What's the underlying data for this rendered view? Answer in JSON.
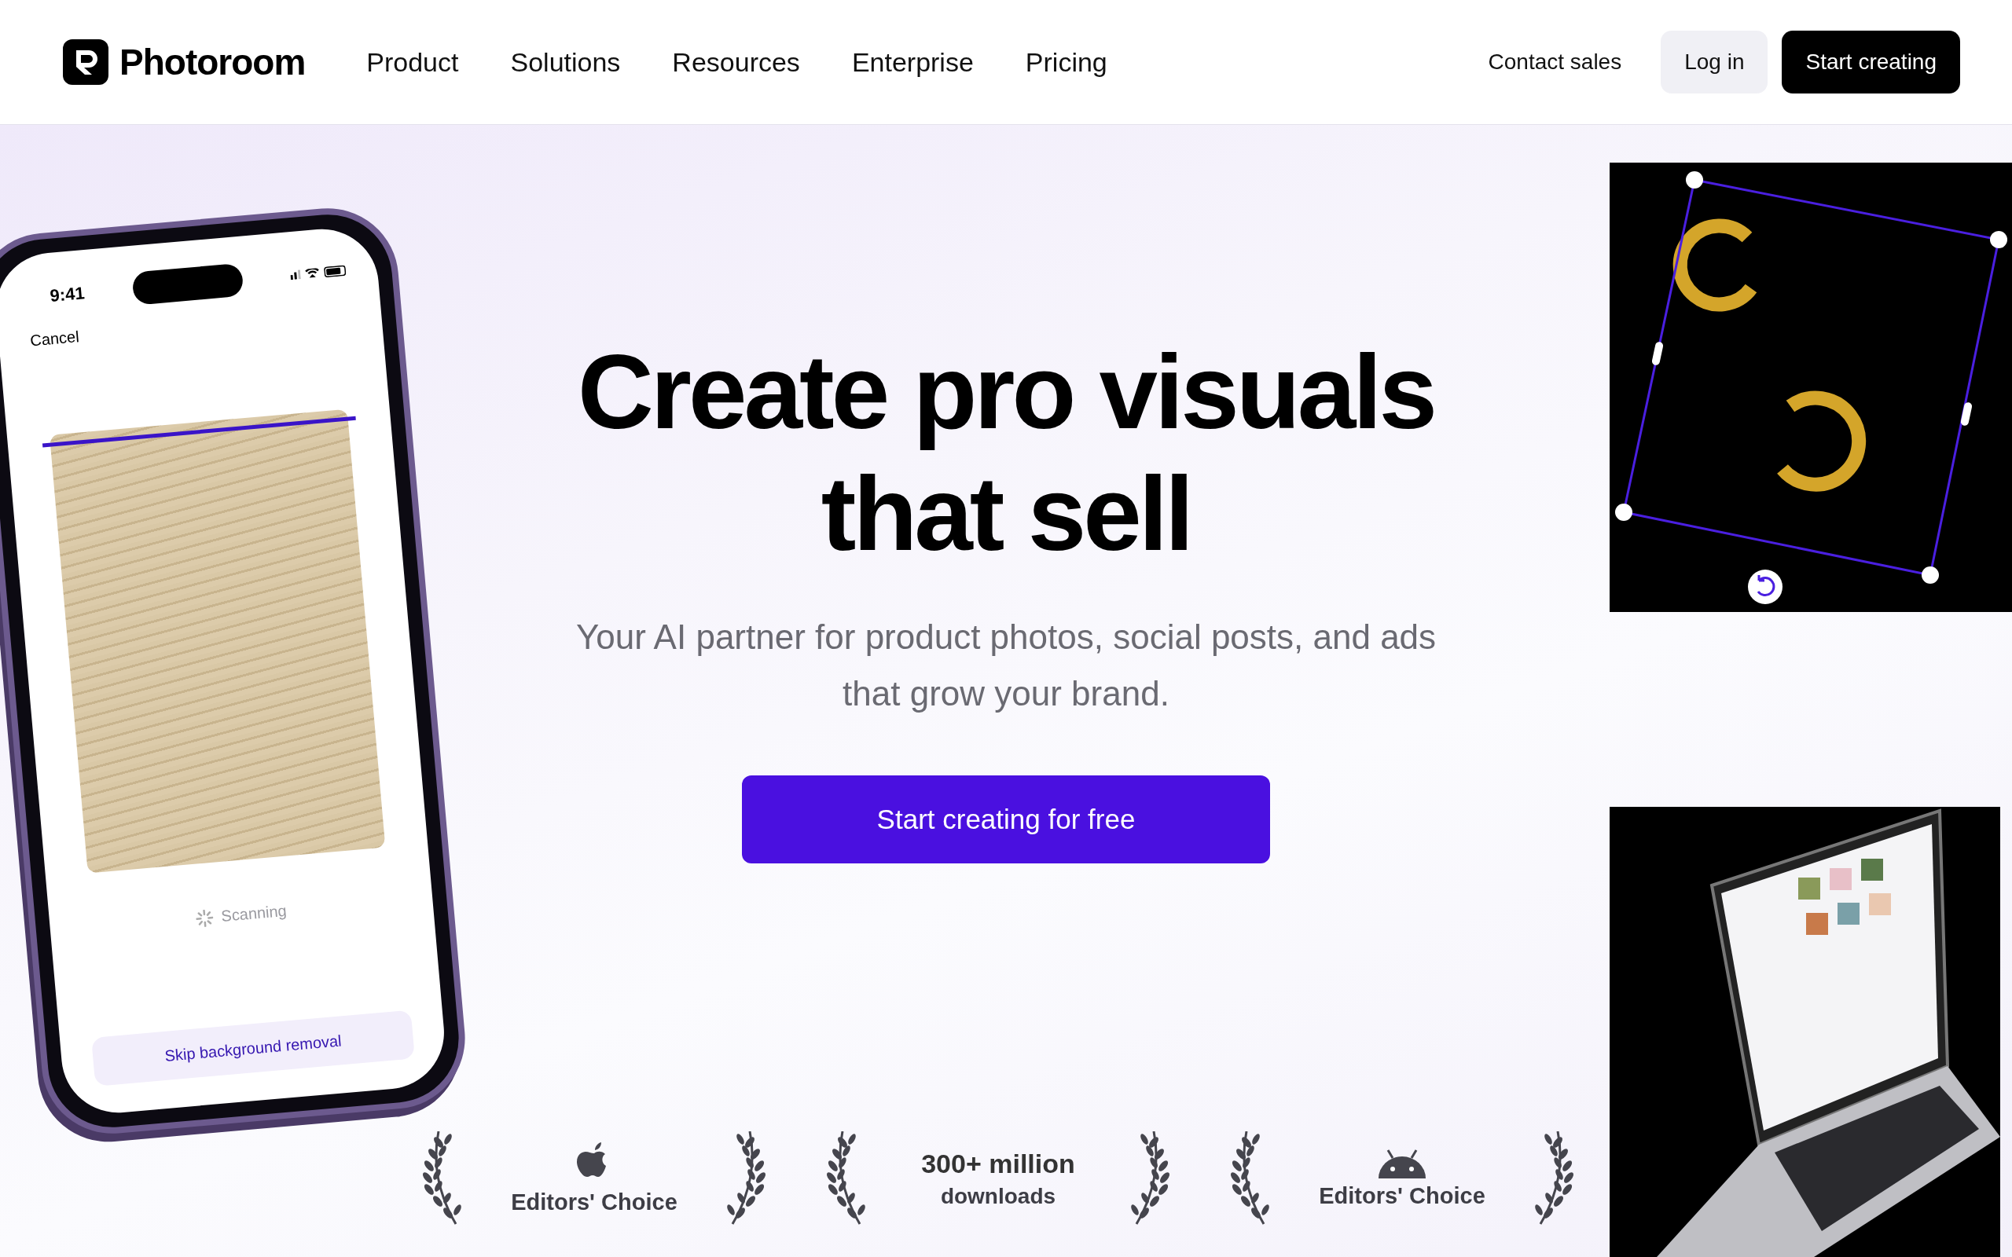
{
  "header": {
    "logo": "Photoroom",
    "nav": [
      "Product",
      "Solutions",
      "Resources",
      "Enterprise",
      "Pricing"
    ],
    "contact": "Contact sales",
    "login": "Log in",
    "cta": "Start creating"
  },
  "hero": {
    "title_lines": [
      "Create pro visuals",
      "that sell"
    ],
    "subtitle_lines": [
      "Your AI partner for product photos, social posts, and ads",
      "that grow your brand."
    ],
    "cta": "Start creating for free"
  },
  "phone": {
    "time": "9:41",
    "cancel": "Cancel",
    "status": "Scanning",
    "skip_button": "Skip background removal"
  },
  "awards": [
    {
      "kind": "apple",
      "label": "Editors' Choice"
    },
    {
      "kind": "stat",
      "value": "300+ million",
      "label": "downloads"
    },
    {
      "kind": "android",
      "label": "Editors' Choice"
    }
  ]
}
